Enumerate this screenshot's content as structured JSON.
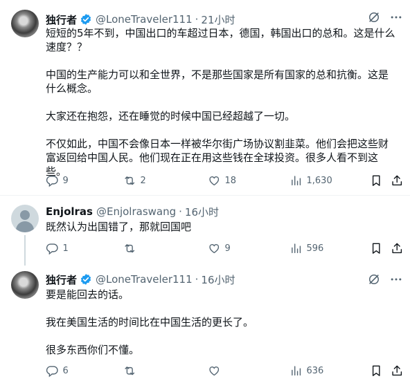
{
  "tweets": [
    {
      "name": "独行者",
      "handle": "@LoneTraveler111",
      "time": "21小时",
      "paragraphs": [
        "短短的5年不到，中国出口的车超过日本，德国，韩国出口的总和。这是什么速度？？",
        "中国的生产能力可以和全世界，不是那些国家是所有国家的总和抗衡。这是什么概念。",
        "大家还在抱怨，还在睡觉的时候中国已经超越了一切。",
        "不仅如此，中国不会像日本一样被华尔街广场协议割韭菜。他们会把这些财富返回给中国人民。他们现在正在用这些钱在全球投资。很多人看不到这些。"
      ],
      "replies": "9",
      "retweets": "2",
      "likes": "18",
      "views": "1,630"
    },
    {
      "name": "Enjolras",
      "handle": "@Enjolraswang",
      "time": "16小时",
      "paragraphs": [
        "既然认为出国错了，那就回国吧"
      ],
      "replies": "1",
      "retweets": "",
      "likes": "9",
      "views": "596"
    },
    {
      "name": "独行者",
      "handle": "@LoneTraveler111",
      "time": "16小时",
      "paragraphs": [
        "要是能回去的话。",
        "我在美国生活的时间比在中国生活的更长了。",
        "很多东西你们不懂。"
      ],
      "replies": "6",
      "retweets": "",
      "likes": "",
      "views": "636"
    }
  ],
  "separator": "·",
  "icons": {
    "verified": "verified-badge-icon",
    "grok": "grok-icon",
    "more": "more-options-icon",
    "reply": "reply-icon",
    "retweet": "retweet-icon",
    "like": "heart-icon",
    "views": "views-chart-icon",
    "bookmark": "bookmark-icon",
    "share": "share-icon"
  },
  "colors": {
    "verified": "#1d9bf0",
    "text": "#0f1419",
    "muted": "#536471"
  }
}
